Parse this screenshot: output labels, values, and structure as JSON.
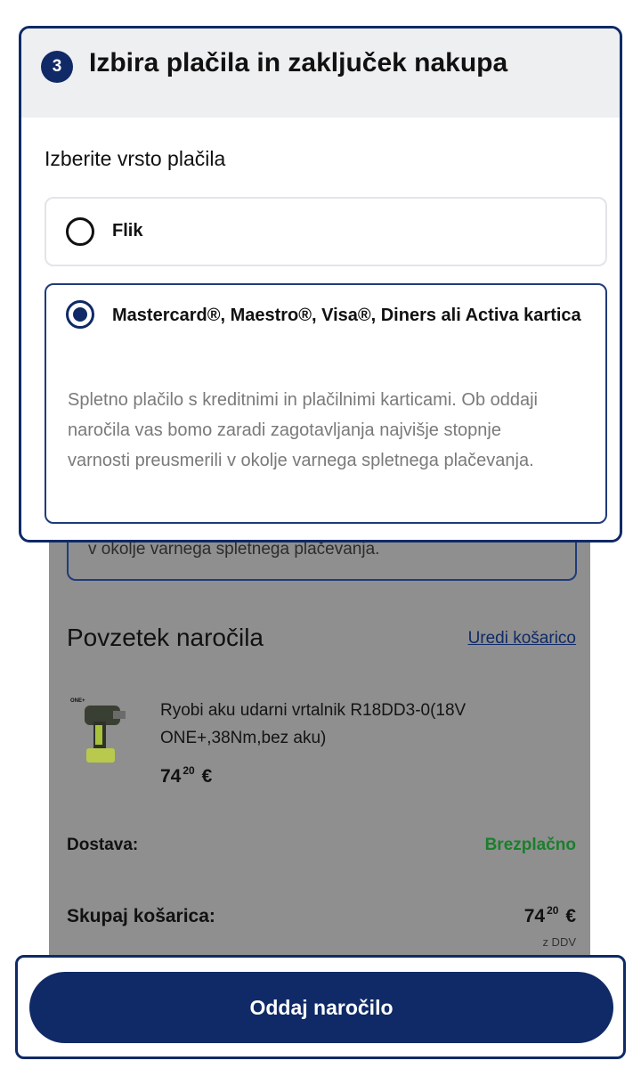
{
  "payment_section": {
    "step_number": "3",
    "title": "Izbira plačila in zaključek nakupa",
    "select_label": "Izberite vrsto plačila",
    "options": [
      {
        "label": "Flik",
        "selected": false
      },
      {
        "label": "Mastercard®, Maestro®, Visa®, Diners ali Activa kartica",
        "selected": true,
        "description": "Spletno plačilo s kreditnimi in plačilnimi karticami. Ob oddaji naročila vas bomo zaradi zagotavljanja najvišje stopnje varnosti preusmerili v okolje varnega spletnega plačevanja."
      }
    ]
  },
  "background": {
    "partial_description": "v okolje varnega spletnega plačevanja."
  },
  "order_summary": {
    "title": "Povzetek naročila",
    "edit_cart_link": "Uredi košarico",
    "product": {
      "name": "Ryobi aku udarni vrtalnik R18DD3-0(18V ONE+,38Nm,bez aku)",
      "image_badge": "ONE+",
      "price_whole": "74",
      "price_cents": "20",
      "currency": "€"
    },
    "shipping_label": "Dostava:",
    "shipping_value": "Brezplačno",
    "total_label": "Skupaj košarica:",
    "total_whole": "74",
    "total_cents": "20",
    "total_currency": "€",
    "vat_note": "z DDV"
  },
  "cta": {
    "label": "Oddaj naročilo"
  },
  "colors": {
    "brand": "#0f2a66",
    "free_shipping": "#1b7f2c",
    "overlay_gray": "#8f8f8f"
  }
}
